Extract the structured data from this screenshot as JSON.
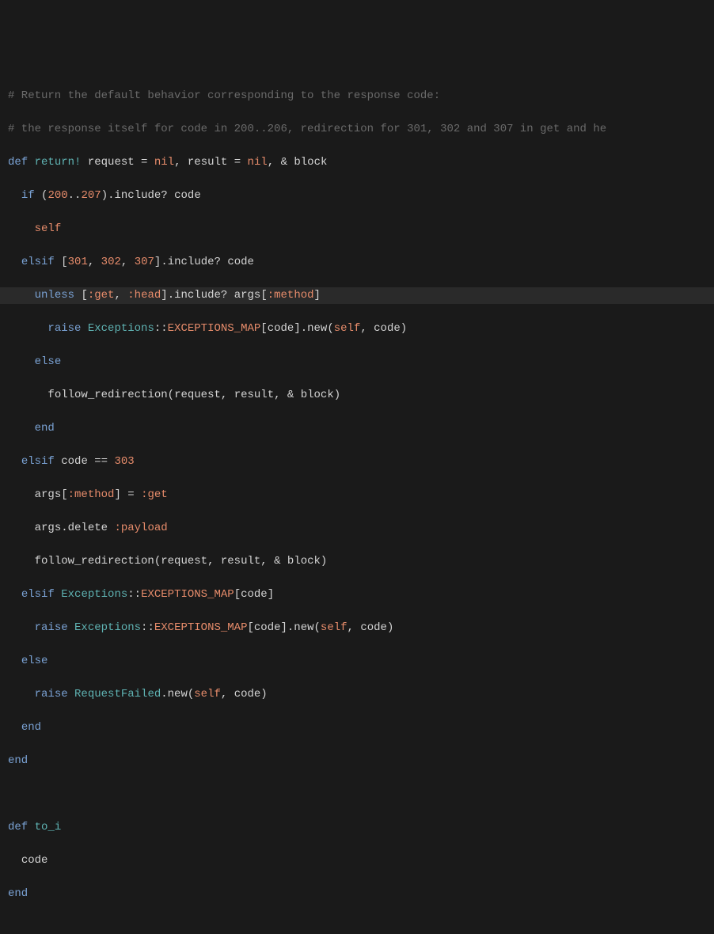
{
  "code": {
    "comment1": "# Return the default behavior corresponding to the response code:",
    "comment2": "# the response itself for code in 200..206, redirection for 301, 302 and 307 in get and he",
    "def": "def",
    "return_bang": "return!",
    "request": "request",
    "eq": " = ",
    "nil": "nil",
    "comma": ", ",
    "result": "result",
    "amp_block": "& block",
    "if": "if",
    "lparen": "(",
    "n200": "200",
    "dotdot": "..",
    "n207": "207",
    "rparen": ")",
    "include_q": ".include? ",
    "code_ident": "code",
    "self": "self",
    "elsif": "elsif",
    "lbrack": "[",
    "n301": "301",
    "n302": "302",
    "n307": "307",
    "rbrack": "]",
    "unless": "unless",
    "sym_get": ":get",
    "sym_head": ":head",
    "args": "args",
    "sym_method": ":method",
    "raise": "raise",
    "exceptions": "Exceptions",
    "colcol": "::",
    "exmap": "EXCEPTIONS_MAP",
    "dotnew": ".new(",
    "else": "else",
    "follow_redirection": "follow_redirection",
    "end": "end",
    "eqeq": " == ",
    "n303": "303",
    "assign": " = ",
    "dotdelete": ".delete ",
    "sym_payload": ":payload",
    "request_failed": "RequestFailed",
    "to_i": "to_i"
  }
}
